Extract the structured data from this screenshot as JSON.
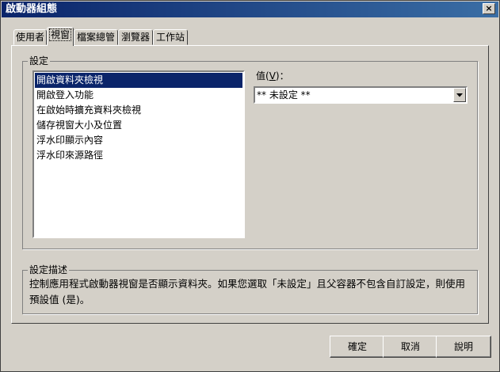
{
  "window": {
    "title": "啟動器組態",
    "close_label": "×"
  },
  "tabs": [
    {
      "label": "使用者",
      "active": false
    },
    {
      "label": "視窗",
      "active": true
    },
    {
      "label": "檔案總管",
      "active": false
    },
    {
      "label": "瀏覽器",
      "active": false
    },
    {
      "label": "工作站",
      "active": false
    }
  ],
  "settings_group": {
    "label": "設定",
    "items": [
      "開啟資料夾檢視",
      "開啟登入功能",
      "在啟始時擴充資料夾檢視",
      "儲存視窗大小及位置",
      "浮水印顯示內容",
      "浮水印來源路徑"
    ],
    "selected_index": 0,
    "value_label_prefix": "值(",
    "value_label_hotkey": "V",
    "value_label_suffix": ")：",
    "value_selected": "** 未設定 **"
  },
  "description_group": {
    "label": "設定描述",
    "text": "控制應用程式啟動器視窗是否顯示資料夾。如果您選取「未設定」且父容器不包含自訂設定，則使用預設值 (是)。"
  },
  "buttons": {
    "ok": "確定",
    "cancel": "取消",
    "help": "說明"
  },
  "icons": {
    "dropdown": "chevron-down-icon",
    "close": "close-icon"
  }
}
